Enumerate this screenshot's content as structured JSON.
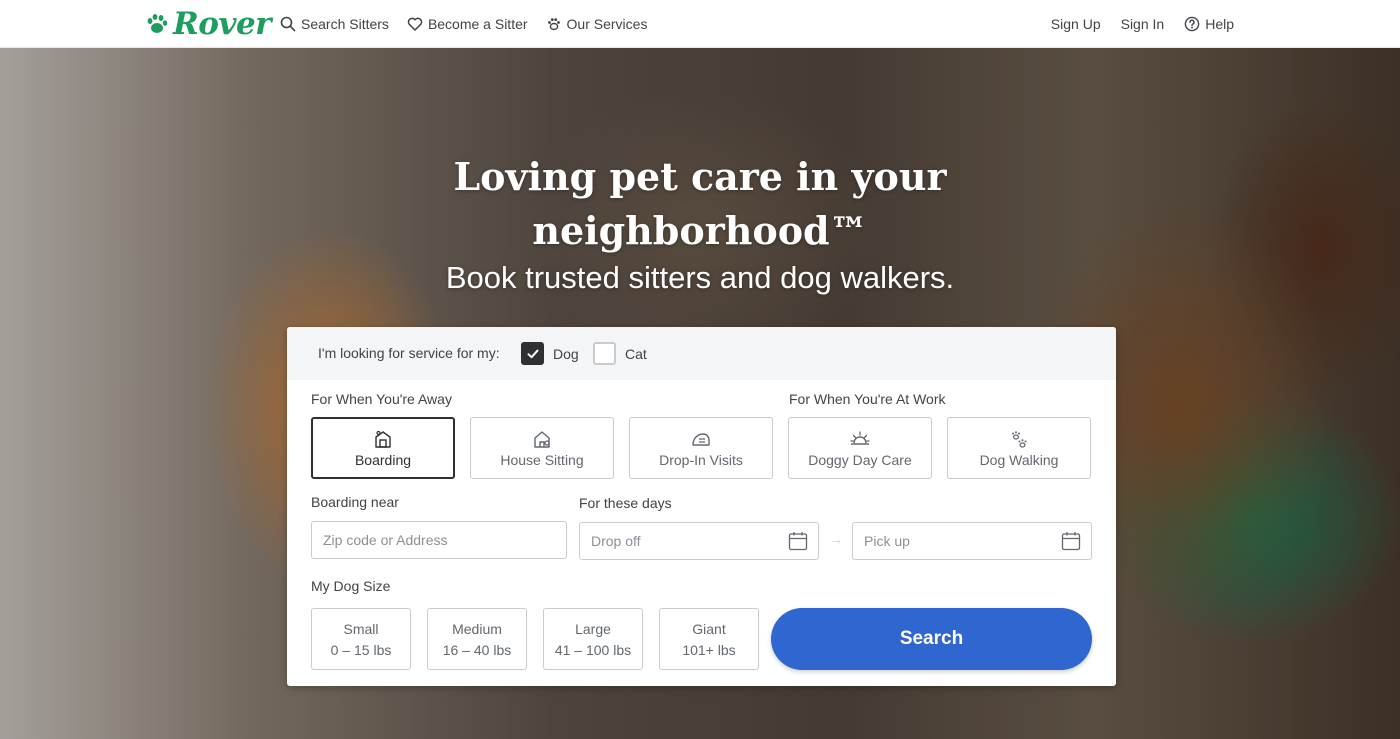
{
  "brand": {
    "name": "Rover",
    "color": "#1d9d5f"
  },
  "nav": {
    "left": [
      {
        "label": "Search Sitters",
        "icon": "search-icon"
      },
      {
        "label": "Become a Sitter",
        "icon": "heart-icon"
      },
      {
        "label": "Our Services",
        "icon": "paw-icon"
      }
    ],
    "right": [
      {
        "label": "Sign Up"
      },
      {
        "label": "Sign In"
      },
      {
        "label": "Help",
        "icon": "help-icon"
      }
    ]
  },
  "hero": {
    "title_line1": "Loving pet care in your",
    "title_line2": "neighborhood™",
    "subtitle": "Book trusted sitters and dog walkers."
  },
  "search": {
    "pet_label": "I'm looking for service for my:",
    "pets": [
      {
        "label": "Dog",
        "checked": true
      },
      {
        "label": "Cat",
        "checked": false
      }
    ],
    "away_label": "For When You're Away",
    "work_label": "For When You're At Work",
    "services": [
      {
        "label": "Boarding",
        "icon": "boarding-icon",
        "selected": true
      },
      {
        "label": "House Sitting",
        "icon": "house-icon",
        "selected": false
      },
      {
        "label": "Drop-In Visits",
        "icon": "drop-in-icon",
        "selected": false
      },
      {
        "label": "Doggy Day Care",
        "icon": "sun-icon",
        "selected": false
      },
      {
        "label": "Dog Walking",
        "icon": "paw-prints-icon",
        "selected": false
      }
    ],
    "near_label": "Boarding near",
    "address_placeholder": "Zip code or Address",
    "days_label": "For these days",
    "dropoff_placeholder": "Drop off",
    "pickup_placeholder": "Pick up",
    "arrow": "→",
    "size_label": "My Dog Size",
    "sizes": [
      {
        "name": "Small",
        "range": "0 – 15 lbs"
      },
      {
        "name": "Medium",
        "range": "16 – 40 lbs"
      },
      {
        "name": "Large",
        "range": "41 – 100 lbs"
      },
      {
        "name": "Giant",
        "range": "101+ lbs"
      }
    ],
    "search_button": "Search",
    "button_color": "#2f66cf"
  }
}
